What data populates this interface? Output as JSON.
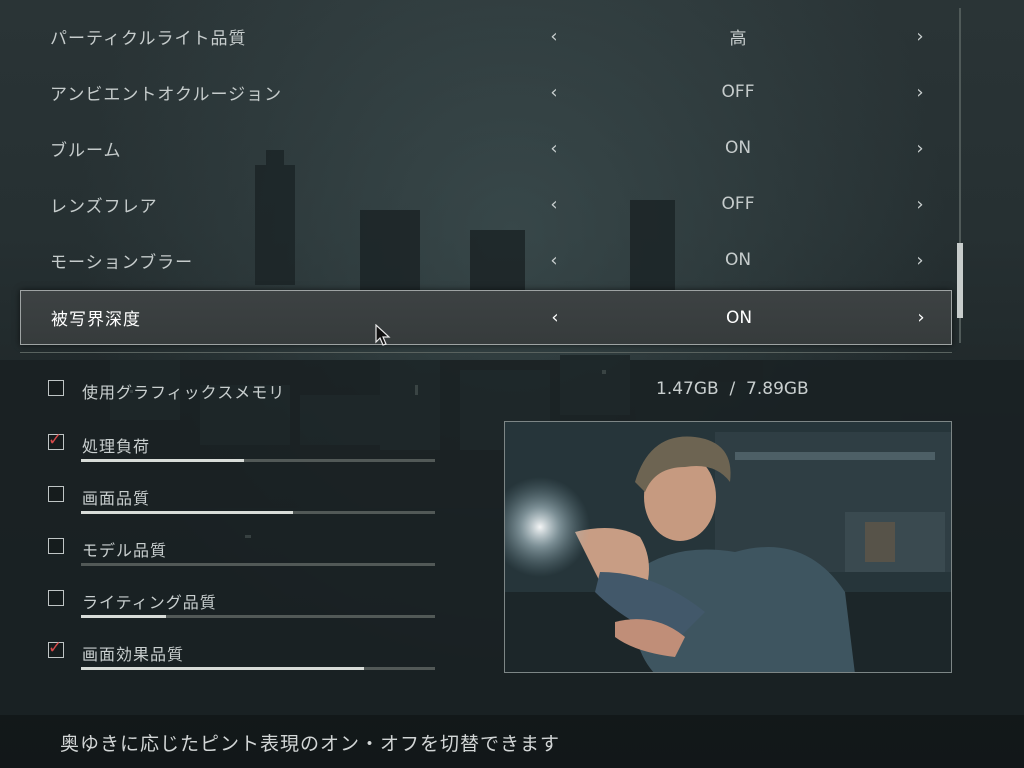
{
  "settings": [
    {
      "label": "パーティクルライト品質",
      "value": "高",
      "selected": false
    },
    {
      "label": "アンビエントオクルージョン",
      "value": "OFF",
      "selected": false
    },
    {
      "label": "ブルーム",
      "value": "ON",
      "selected": false
    },
    {
      "label": "レンズフレア",
      "value": "OFF",
      "selected": false
    },
    {
      "label": "モーションブラー",
      "value": "ON",
      "selected": false
    },
    {
      "label": "被写界深度",
      "value": "ON",
      "selected": true
    }
  ],
  "arrows": {
    "left": "‹",
    "right": "›"
  },
  "vram": {
    "label": "使用グラフィックスメモリ",
    "value": "1.47GB  /  7.89GB",
    "checked": false
  },
  "load_items": [
    {
      "label": "処理負荷",
      "checked": true,
      "fill": 0.46
    },
    {
      "label": "画面品質",
      "checked": false,
      "fill": 0.6
    },
    {
      "label": "モデル品質",
      "checked": false,
      "fill": 0.0
    },
    {
      "label": "ライティング品質",
      "checked": false,
      "fill": 0.24
    },
    {
      "label": "画面効果品質",
      "checked": true,
      "fill": 0.8
    }
  ],
  "help": {
    "text": "奥ゆきに応じたピント表現のオン・オフを切替できます"
  },
  "colors": {
    "check": "#d64a4a",
    "accent_border": "#9ea3a3"
  },
  "icons": {
    "check": "check-icon",
    "cursor": "mouse-cursor-icon"
  }
}
